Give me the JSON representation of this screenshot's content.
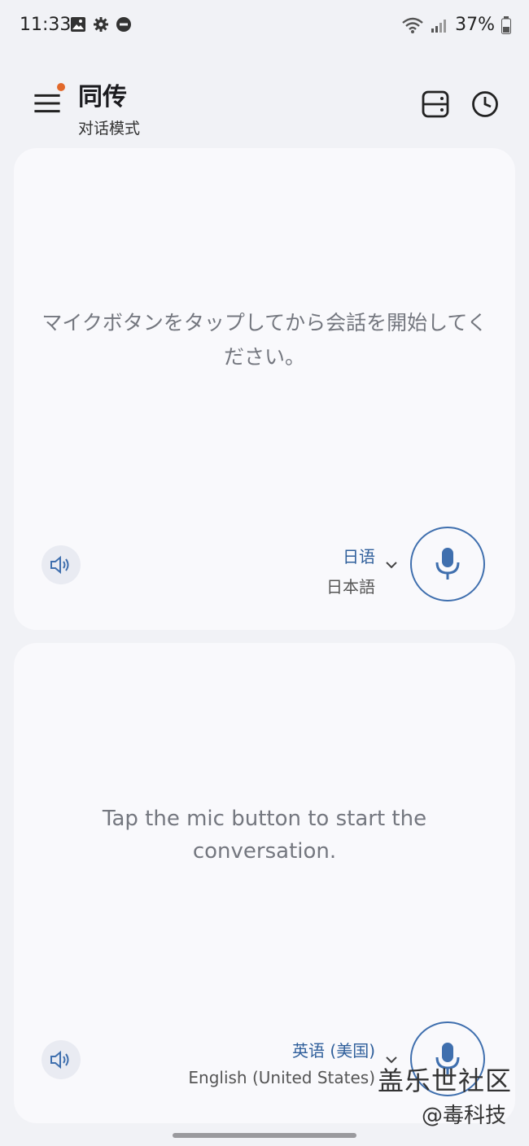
{
  "status": {
    "time": "11:33",
    "battery": "37%"
  },
  "app": {
    "title": "同传",
    "subtitle": "对话模式"
  },
  "top_card": {
    "prompt": "マイクボタンをタップしてから会話を開始してください。",
    "language_name": "日语",
    "language_native": "日本語"
  },
  "bottom_card": {
    "prompt": "Tap the mic button to start the conversation.",
    "language_name": "英语 (美国)",
    "language_native": "English (United States)"
  },
  "watermark": {
    "line1": "盖乐世社区",
    "line2": "@毒科技"
  },
  "colors": {
    "accent": "#3f6fae",
    "badge": "#e2692b",
    "card": "#f9f9fc",
    "background": "#f1f2f6"
  }
}
